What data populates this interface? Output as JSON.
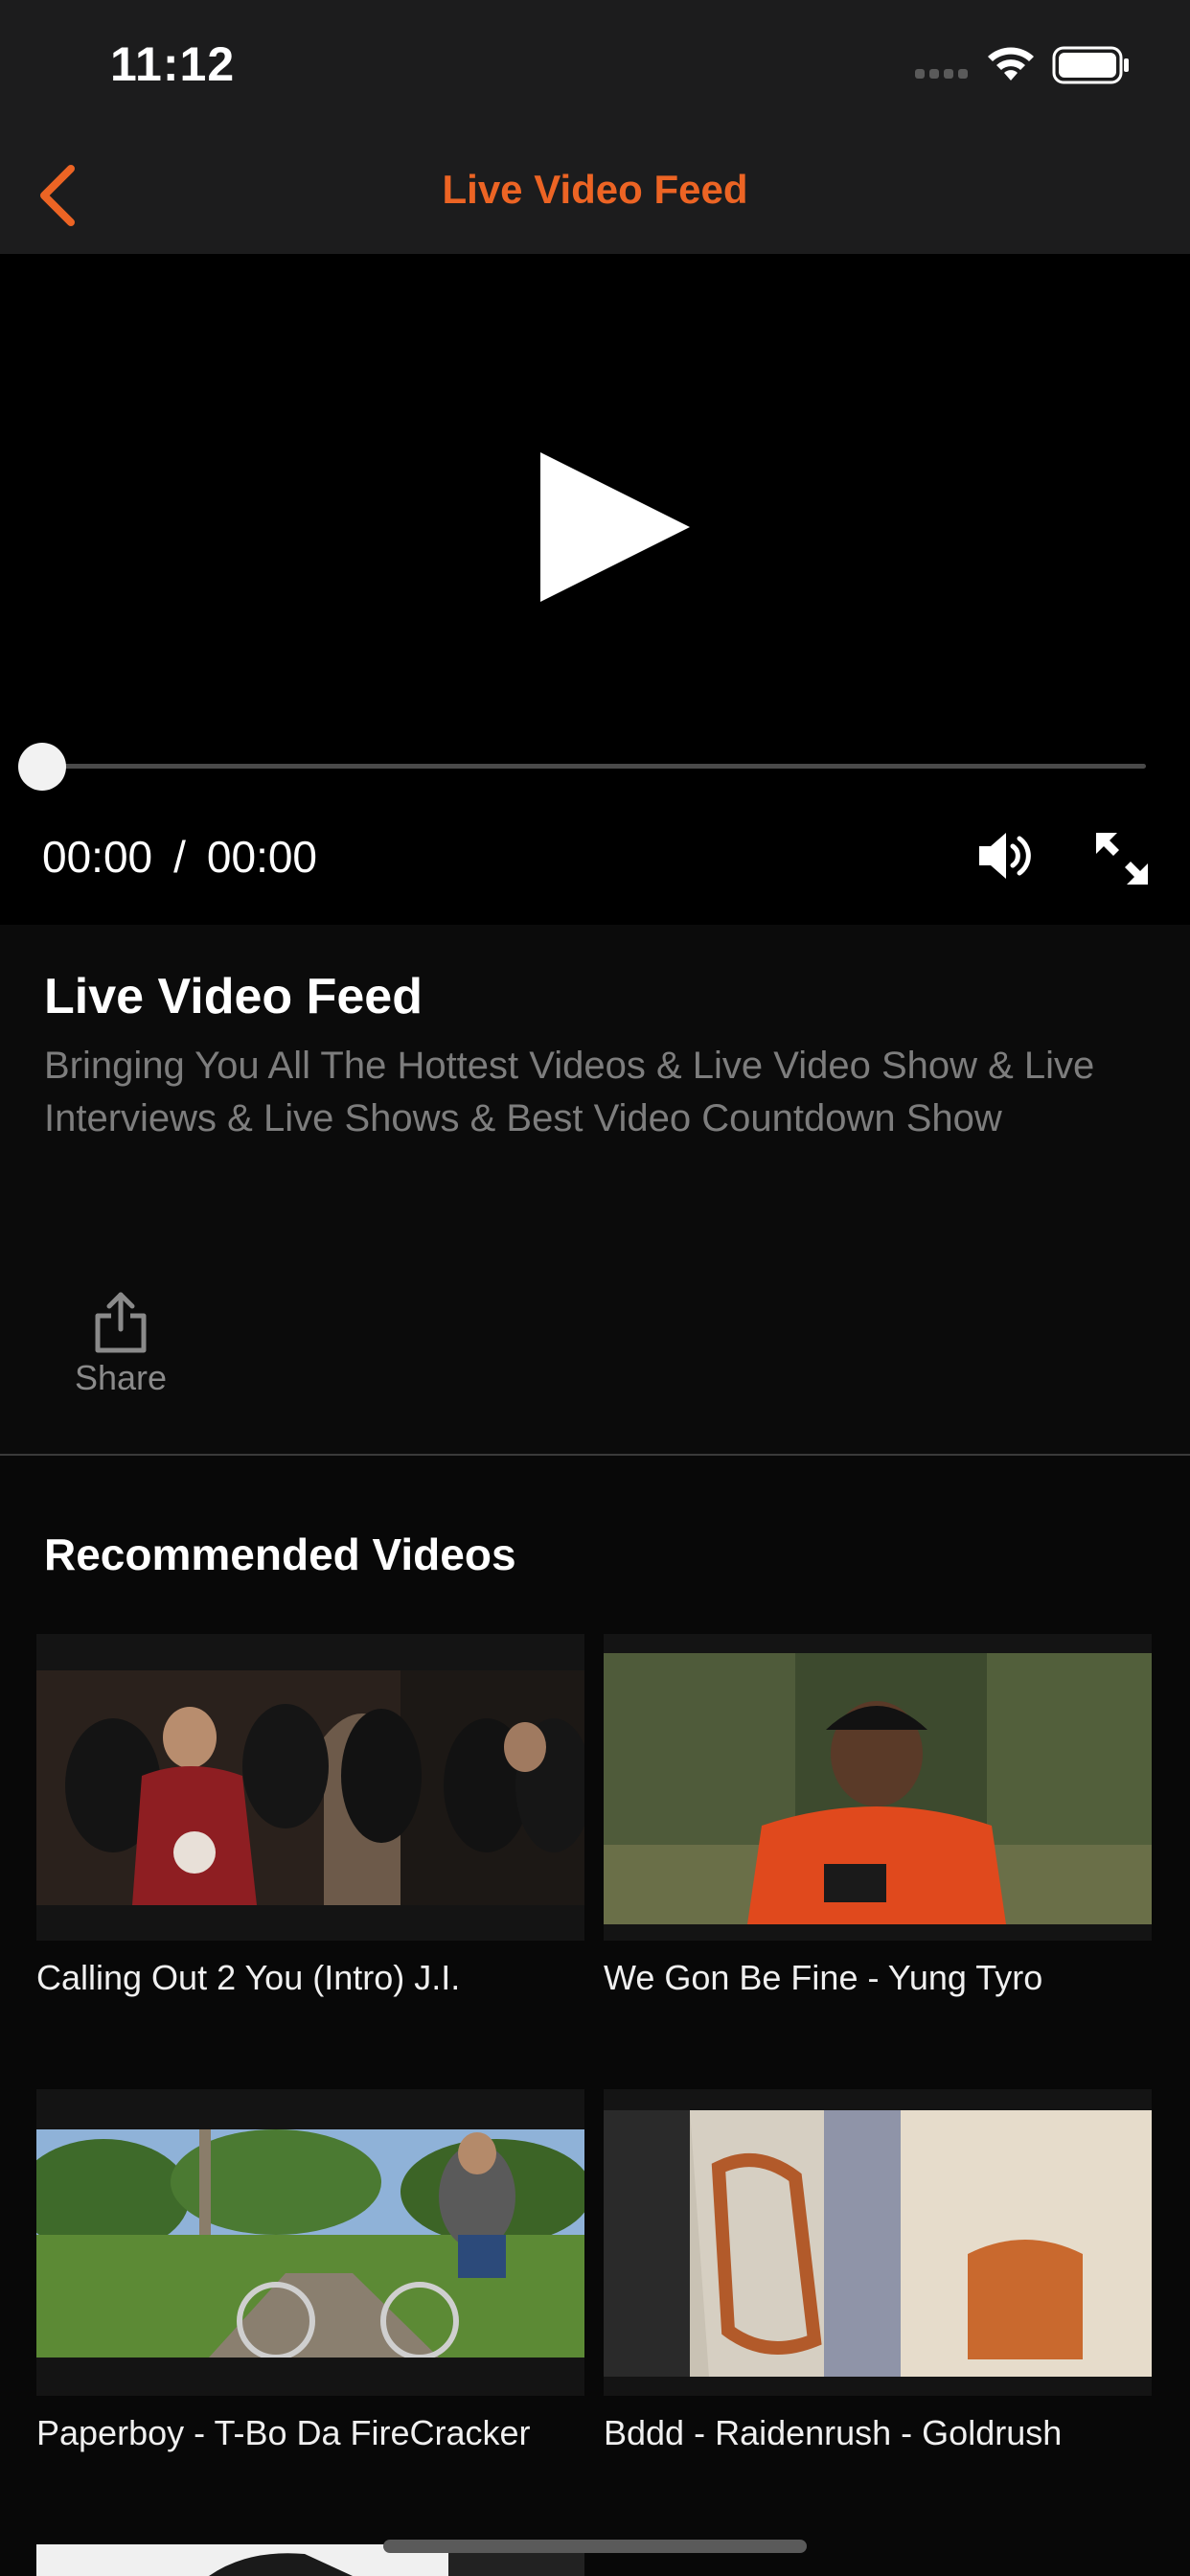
{
  "status_bar": {
    "time": "11:12",
    "icons": [
      "signal-dots-icon",
      "wifi-icon",
      "battery-icon"
    ]
  },
  "nav": {
    "back_icon": "chevron-left-icon",
    "title": "Live Video Feed",
    "accent_color": "#ec6424"
  },
  "player": {
    "play_icon": "play-icon",
    "progress": 0,
    "current_time": "00:00",
    "separator": "/",
    "duration": "00:00",
    "volume_icon": "volume-icon",
    "fullscreen_icon": "fullscreen-icon"
  },
  "info": {
    "title": "Live Video Feed",
    "description": "Bringing You All The Hottest Videos & Live Video Show & Live Interviews  & Live Shows & Best Video Countdown Show",
    "share_label": "Share",
    "share_icon": "share-icon"
  },
  "recommended": {
    "heading": "Recommended Videos",
    "videos": [
      {
        "title": "Calling Out 2 You (Intro) J.I."
      },
      {
        "title": "We Gon Be Fine - Yung Tyro"
      },
      {
        "title": "Paperboy - T-Bo Da FireCracker"
      },
      {
        "title": "Bddd - Raidenrush - Goldrush"
      }
    ]
  }
}
